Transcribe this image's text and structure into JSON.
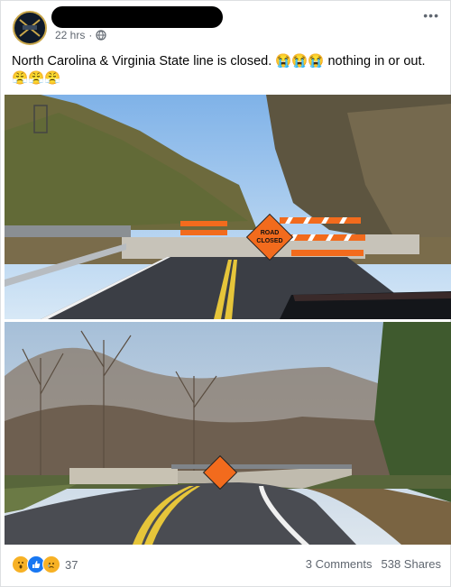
{
  "post": {
    "time": "22 hrs",
    "dot": "·",
    "text": "North Carolina & Virginia State line is closed. 😭😭😭 nothing in or out. 😤😤😤",
    "more_label": "•••"
  },
  "photo1": {
    "sign_text_1": "ROAD",
    "sign_text_2": "CLOSED"
  },
  "footer": {
    "reaction_count": "37",
    "comments": "3 Comments",
    "shares": "538 Shares"
  },
  "colors": {
    "meta": "#606770",
    "like": "#1877f2",
    "wow": "#f7b125",
    "sign": "#f26b1d"
  }
}
